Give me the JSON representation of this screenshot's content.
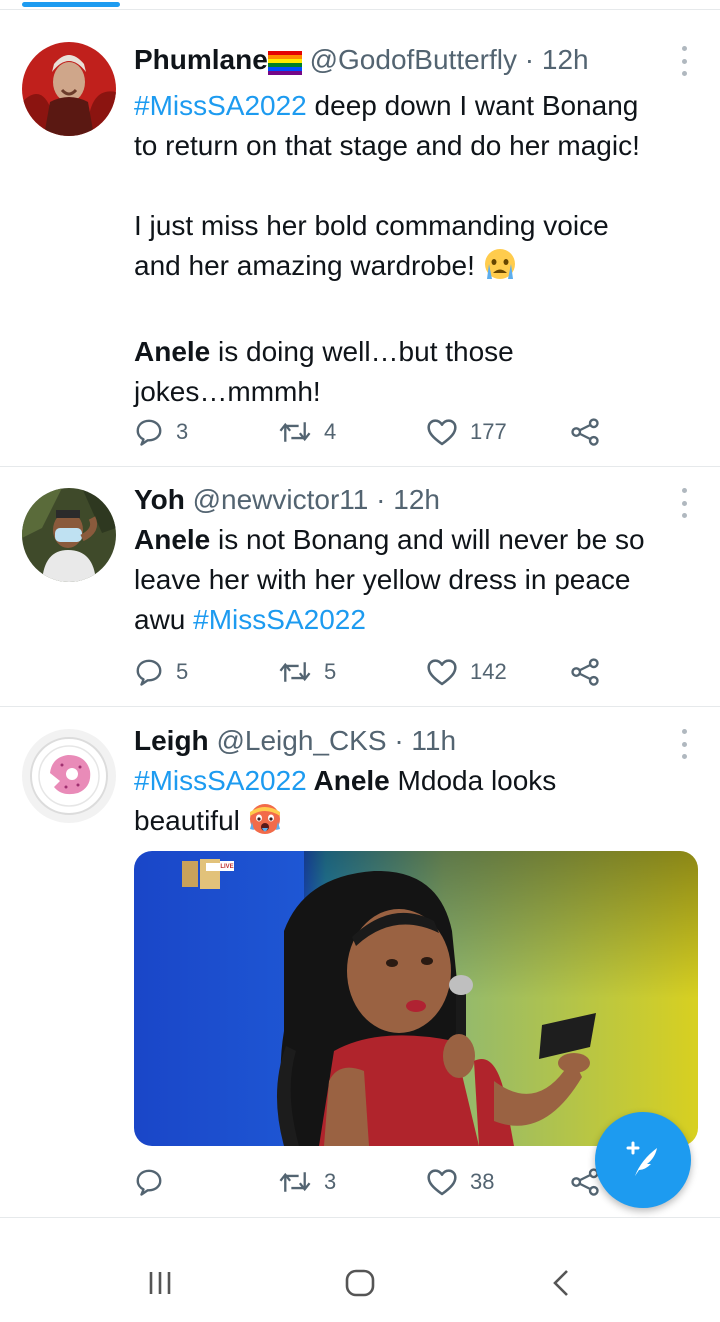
{
  "colors": {
    "accent": "#1d9bf0",
    "text": "#0f1419",
    "muted": "#536471",
    "divider": "#e6e9eb"
  },
  "tweets": [
    {
      "name": "Phumlane",
      "name_emoji": "rainbow-flag",
      "handle": "@GodofButterfly",
      "time": "12h",
      "hashtag": "#MissSA2022",
      "line1_rest": " deep down I want Bonang",
      "line2": "to return on that stage and do her magic!",
      "line3": "I just miss her bold commanding voice",
      "line4": "and her amazing wardrobe! ",
      "line4_emoji": "crying-face",
      "line5_bold": "Anele",
      "line5_rest": " is doing well…but those",
      "line6": "jokes…mmmh!",
      "replies": "3",
      "retweets": "4",
      "likes": "177"
    },
    {
      "name": "Yoh",
      "handle": "@newvictor11",
      "time": "12h",
      "line1_bold": "Anele",
      "line1_rest": " is not Bonang and will never be so",
      "line2": "leave her with her yellow dress in peace",
      "line3_pre": "awu ",
      "hashtag": "#MissSA2022",
      "replies": "5",
      "retweets": "5",
      "likes": "142"
    },
    {
      "name": "Leigh",
      "handle": "@Leigh_CKS",
      "time": "11h",
      "hashtag": "#MissSA2022",
      "line1_bold": " Anele",
      "line1_rest": " Mdoda looks",
      "line2": "beautiful ",
      "line2_emoji": "hot-face",
      "media_badge": "LIVE",
      "replies": "",
      "retweets": "3",
      "likes": "38"
    }
  ],
  "separator": "·",
  "fab": {
    "icon": "compose-tweet-icon"
  },
  "navbar": {
    "icons": [
      "recent-apps-icon",
      "home-icon",
      "back-icon"
    ]
  }
}
